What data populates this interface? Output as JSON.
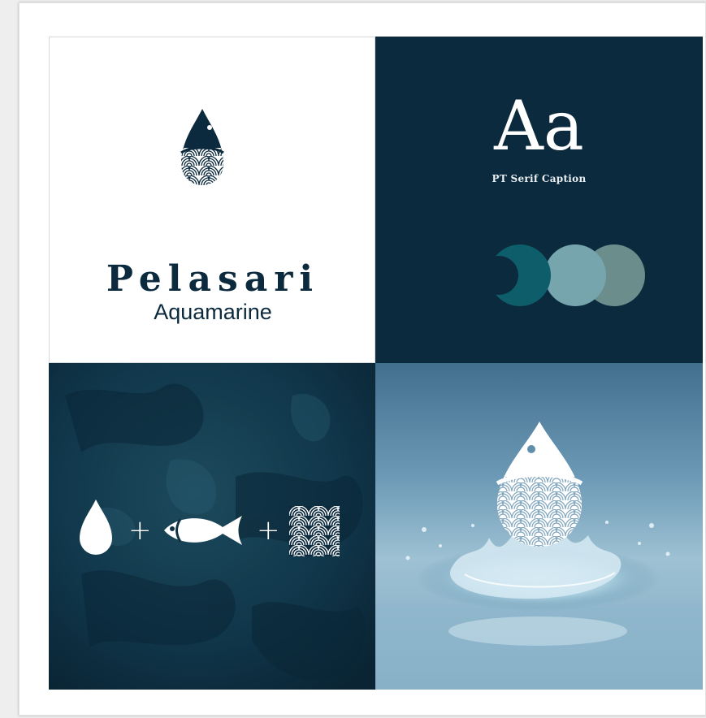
{
  "brand": {
    "name": "Pelasari",
    "subtitle": "Aquamarine",
    "logo_icon": "drop-fish-wave-icon"
  },
  "typography": {
    "sample": "Aa",
    "font_name": "PT Serif Caption"
  },
  "palette": {
    "swatches": [
      "#0d5e6a",
      "#77a5ad",
      "#6b8d8b"
    ],
    "background": "#0c2a3d"
  },
  "construction": {
    "parts": [
      "drop-icon",
      "fish-icon",
      "wave-pattern-icon"
    ],
    "operator": "+"
  },
  "mockup": {
    "icon": "drop-fish-wave-icon",
    "scene": "water-splash"
  }
}
